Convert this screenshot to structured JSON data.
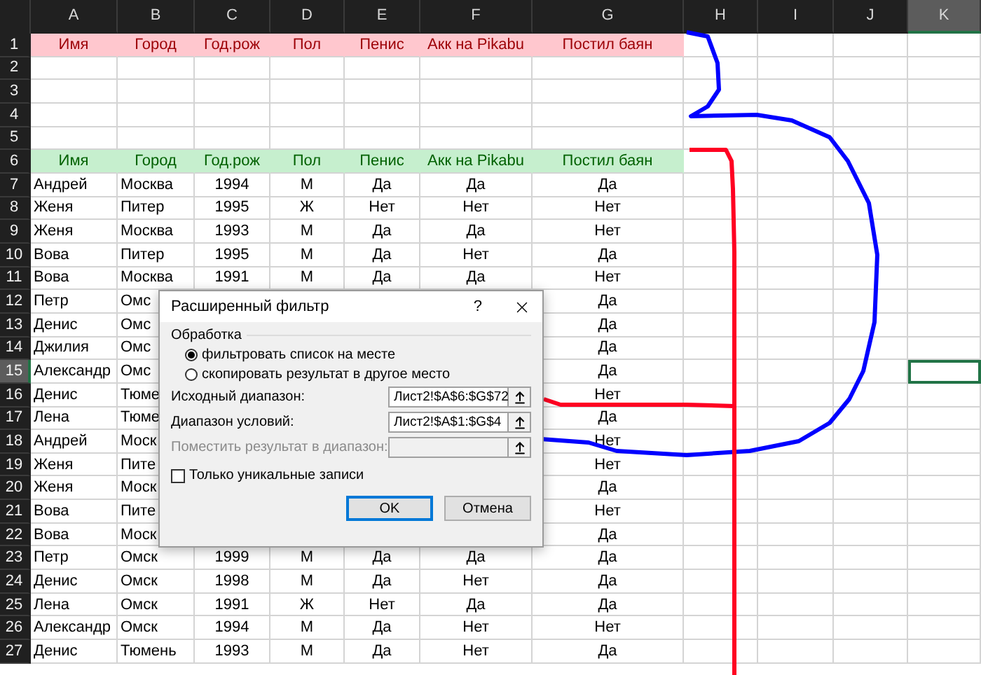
{
  "columns": [
    {
      "letter": "A",
      "selected": false
    },
    {
      "letter": "B",
      "selected": false
    },
    {
      "letter": "C",
      "selected": false
    },
    {
      "letter": "D",
      "selected": false
    },
    {
      "letter": "E",
      "selected": false
    },
    {
      "letter": "F",
      "selected": false
    },
    {
      "letter": "G",
      "selected": false
    },
    {
      "letter": "H",
      "selected": false
    },
    {
      "letter": "I",
      "selected": false
    },
    {
      "letter": "J",
      "selected": false
    },
    {
      "letter": "K",
      "selected": true
    }
  ],
  "rows": [
    {
      "number": "1",
      "kind": "criteria",
      "selected": false,
      "a": "Имя",
      "b": "Город",
      "c": "Год.рож",
      "d": "Пол",
      "e": "Пенис",
      "f": "Акк на Pikabu",
      "g": "Постил баян"
    },
    {
      "number": "2",
      "kind": "data",
      "selected": false
    },
    {
      "number": "3",
      "kind": "data",
      "selected": false
    },
    {
      "number": "4",
      "kind": "data",
      "selected": false
    },
    {
      "number": "5",
      "kind": "data",
      "selected": false
    },
    {
      "number": "6",
      "kind": "header",
      "selected": false,
      "a": "Имя",
      "b": "Город",
      "c": "Год.рож",
      "d": "Пол",
      "e": "Пенис",
      "f": "Акк на Pikabu",
      "g": "Постил баян"
    },
    {
      "number": "7",
      "kind": "data",
      "selected": false,
      "a": "Андрей",
      "b": "Москва",
      "c": "1994",
      "d": "М",
      "e": "Да",
      "f": "Да",
      "g": "Да"
    },
    {
      "number": "8",
      "kind": "data",
      "selected": false,
      "a": "Женя",
      "b": "Питер",
      "c": "1995",
      "d": "Ж",
      "e": "Нет",
      "f": "Нет",
      "g": "Нет"
    },
    {
      "number": "9",
      "kind": "data",
      "selected": false,
      "a": "Женя",
      "b": "Москва",
      "c": "1993",
      "d": "М",
      "e": "Да",
      "f": "Да",
      "g": "Нет"
    },
    {
      "number": "10",
      "kind": "data",
      "selected": false,
      "a": "Вова",
      "b": "Питер",
      "c": "1995",
      "d": "М",
      "e": "Да",
      "f": "Нет",
      "g": "Да"
    },
    {
      "number": "11",
      "kind": "data",
      "selected": false,
      "a": "Вова",
      "b": "Москва",
      "c": "1991",
      "d": "М",
      "e": "Да",
      "f": "Да",
      "g": "Нет"
    },
    {
      "number": "12",
      "kind": "data",
      "selected": false,
      "a": "Петр",
      "b": "Омс",
      "g": "Да"
    },
    {
      "number": "13",
      "kind": "data",
      "selected": false,
      "a": "Денис",
      "b": "Омс",
      "g": "Да"
    },
    {
      "number": "14",
      "kind": "data",
      "selected": false,
      "a": "Джилия",
      "b": "Омс",
      "g": "Да"
    },
    {
      "number": "15",
      "kind": "data",
      "selected": true,
      "a": "Александр",
      "b": "Омс",
      "g": "Да"
    },
    {
      "number": "16",
      "kind": "data",
      "selected": false,
      "a": "Денис",
      "b": "Тюме",
      "g": "Нет"
    },
    {
      "number": "17",
      "kind": "data",
      "selected": false,
      "a": "Лена",
      "b": "Тюме",
      "g": "Да"
    },
    {
      "number": "18",
      "kind": "data",
      "selected": false,
      "a": "Андрей",
      "b": "Моск",
      "g": "Нет"
    },
    {
      "number": "19",
      "kind": "data",
      "selected": false,
      "a": "Женя",
      "b": "Пите",
      "g": "Нет"
    },
    {
      "number": "20",
      "kind": "data",
      "selected": false,
      "a": "Женя",
      "b": "Моск",
      "g": "Да"
    },
    {
      "number": "21",
      "kind": "data",
      "selected": false,
      "a": "Вова",
      "b": "Пите",
      "g": "Нет"
    },
    {
      "number": "22",
      "kind": "data",
      "selected": false,
      "a": "Вова",
      "b": "Моск",
      "g": "Да"
    },
    {
      "number": "23",
      "kind": "data",
      "selected": false,
      "a": "Петр",
      "b": "Омск",
      "c": "1999",
      "d": "М",
      "e": "Да",
      "f": "Да",
      "g": "Да"
    },
    {
      "number": "24",
      "kind": "data",
      "selected": false,
      "a": "Денис",
      "b": "Омск",
      "c": "1998",
      "d": "М",
      "e": "Да",
      "f": "Нет",
      "g": "Да"
    },
    {
      "number": "25",
      "kind": "data",
      "selected": false,
      "a": "Лена",
      "b": "Омск",
      "c": "1991",
      "d": "Ж",
      "e": "Нет",
      "f": "Да",
      "g": "Да"
    },
    {
      "number": "26",
      "kind": "data",
      "selected": false,
      "a": "Александр",
      "b": "Омск",
      "c": "1994",
      "d": "М",
      "e": "Да",
      "f": "Нет",
      "g": "Нет"
    },
    {
      "number": "27",
      "kind": "data",
      "selected": false,
      "a": "Денис",
      "b": "Тюмень",
      "c": "1993",
      "d": "М",
      "e": "Да",
      "f": "Нет",
      "g": "Да"
    }
  ],
  "dialog": {
    "title": "Расширенный фильтр",
    "help": "?",
    "group": "Обработка",
    "radios": [
      {
        "label": "фильтровать список на месте",
        "selected": true
      },
      {
        "label": "скопировать результат в другое место",
        "selected": false
      }
    ],
    "fields": [
      {
        "label": "Исходный диапазон:",
        "value": "Лист2!$A$6:$G$72",
        "disabled": false
      },
      {
        "label": "Диапазон условий:",
        "value": "Лист2!$A$1:$G$4",
        "disabled": false
      },
      {
        "label": "Поместить результат в диапазон:",
        "disabled": true
      }
    ],
    "checkbox": {
      "label": "Только уникальные записи",
      "checked": false
    },
    "buttons": [
      {
        "label": "OK",
        "default": true
      },
      {
        "label": "Отмена",
        "default": false
      }
    ]
  }
}
